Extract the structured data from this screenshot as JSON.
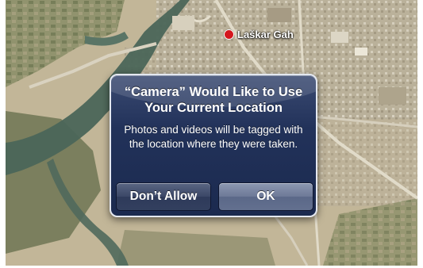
{
  "map": {
    "place_label": "Laškar Gah"
  },
  "alert": {
    "title": "“Camera” Would Like to Use Your Current Location",
    "message": "Photos and videos will be tagged with the location where they were taken.",
    "buttons": {
      "deny_label": "Don’t Allow",
      "ok_label": "OK"
    }
  },
  "colors": {
    "pin": "#d4171e",
    "alert_background": "#22325a",
    "alert_border": "#e4e8f0"
  }
}
